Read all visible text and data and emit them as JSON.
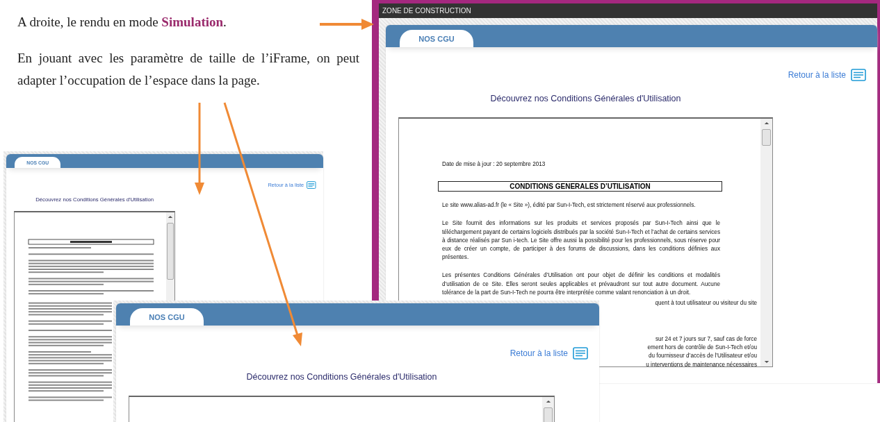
{
  "intro": "A droite, le rendu en mode **Simulation**.",
  "paragraph": "En jouant avec les paramètre de taille de l’iFrame, on peut adapter l’occupation de l’espace dans la page.",
  "views": [
    {
      "kind": "small",
      "tab": {
        "label": "NOS CGU",
        "selected": true
      },
      "back_link": "Retour à la liste",
      "heading": "Découvrez nos Conditions Générales d'Utilisation"
    },
    {
      "kind": "simulation",
      "zone_title": "ZONE DE CONSTRUCTION",
      "tab": {
        "label": "NOS CGU",
        "selected": true
      },
      "back_link": "Retour à la liste",
      "heading": "Découvrez nos Conditions Générales d'Utilisation",
      "document": {
        "date": "Date de mise à jour : 20 septembre 2013",
        "title": "CONDITIONS GENERALES D’UTILISATION",
        "paragraphs": [
          "Le site www.alias-ad.fr (le « Site »), édité par Sun-I-Tech, est strictement réservé aux professionnels.",
          "Le Site fournit des informations sur les produits et services proposés par Sun-I-Tech ainsi que le téléchargement payant de certains logiciels distribués par la société Sun-I-Tech et l’achat de certains services à distance réalisés par Sun i-tech. Le Site offre aussi la possibilité pour les professionnels, sous réserve pour eux de créer un compte, de participer à des forums de discussions, dans les conditions définies aux présentes.",
          "Les présentes Conditions Générales d’Utilisation ont pour objet de définir les conditions et modalités d’utilisation de ce Site. Elles seront seules applicables et prévaudront sur tout autre document. Aucune tolérance de la part de Sun-I-Tech ne pourra être interprétée comme valant renonciation à un droit."
        ],
        "fragments_top": [
          "quent à tout utilisateur ou visiteur du site"
        ],
        "fragments_bottom": [
          "sur 24 et 7 jours sur 7, sauf cas de force",
          "ement hors de contrôle de Sun-I-Tech et/ou",
          "du fournisseur d’accès de l’Utilisateur et/ou",
          "u interventions de maintenance nécessaires"
        ]
      }
    },
    {
      "kind": "medium",
      "tab": {
        "label": "NOS CGU",
        "selected": true
      },
      "back_link": "Retour à la liste",
      "heading": "Découvrez nos Conditions Générales d'Utilisation"
    }
  ]
}
